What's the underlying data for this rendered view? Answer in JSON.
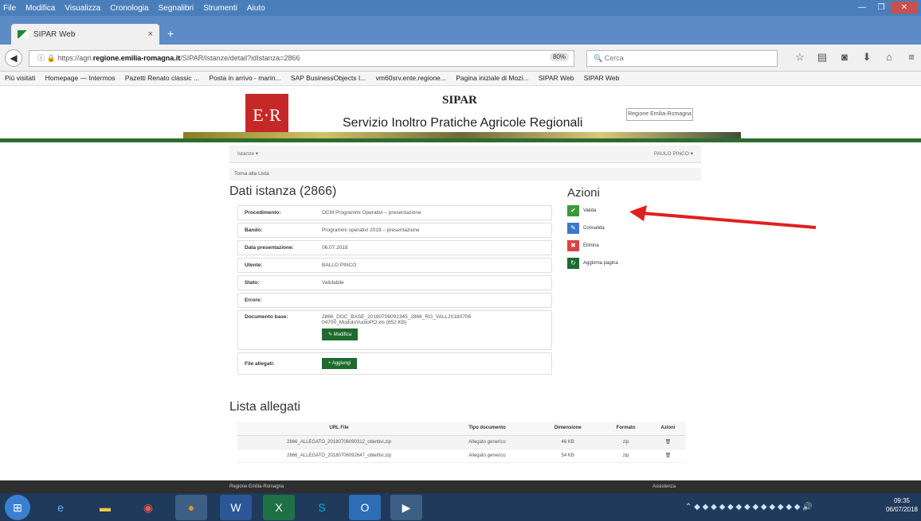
{
  "menu": [
    "File",
    "Modifica",
    "Visualizza",
    "Cronologia",
    "Segnalibri",
    "Strumenti",
    "Aiuto"
  ],
  "tab": {
    "title": "SIPAR Web",
    "close": "×",
    "newtab": "+"
  },
  "nav": {
    "url_prefix": "https://agri.",
    "url_domain": "regione.emilia-romagna.it",
    "url_path": "/SIPAR/istanze/detail?idIstanza=2866",
    "zoom": "80%",
    "search_placeholder": "Cerca"
  },
  "bookmarks": [
    "Più visitati",
    "Homepage — Intermos",
    "Pazetti Renato classic ...",
    "Posta in arrivo - marin...",
    "SAP BusinessObjects I...",
    "vm60srv.ente.regione...",
    "Pagina iniziale di Mozi...",
    "SIPAR Web",
    "SIPAR Web"
  ],
  "header": {
    "logo": "E·R",
    "app": "SIPAR",
    "subtitle": "Servizio Inoltro Pratiche Agricole Regionali",
    "region_logo": "Regione Emilia-Romagna"
  },
  "subnav": {
    "left": "Istanze ▾",
    "right": "PAULO PINCO ▾"
  },
  "back_link": "Torna alla Lista",
  "dati": {
    "title": "Dati istanza (2866)",
    "rows": [
      {
        "k": "Procedimento:",
        "v": "OCM Programmi Operativi – presentazione"
      },
      {
        "k": "Bando:",
        "v": "Programmi operativi 2019 – presentazione"
      },
      {
        "k": "Data presentazione:",
        "v": "06.07.2018"
      },
      {
        "k": "Utente:",
        "v": "BALLO PINCO"
      },
      {
        "k": "Stato:",
        "v": "Validabile"
      },
      {
        "k": "Errore:",
        "v": ""
      }
    ],
    "doc_label": "Documento base:",
    "doc_value": "2866_DOC_BASE_20180706091345_2866_RG_VALL20180706 04700_ModuloVuotoPO.xls (852 KB)",
    "modifica": "Modifica",
    "allegati_label": "File allegati:",
    "aggiungi": "Aggiungi"
  },
  "azioni": {
    "title": "Azioni",
    "items": [
      {
        "label": "Valida",
        "color": "#3a9a3a",
        "icon": "✔"
      },
      {
        "label": "Convalida",
        "color": "#3a7ac8",
        "icon": "✎"
      },
      {
        "label": "Elimina",
        "color": "#d64545",
        "icon": "🗑"
      },
      {
        "label": "Aggiorna pagina",
        "color": "#1e6b2e",
        "icon": "↻"
      }
    ]
  },
  "lista": {
    "title": "Lista allegati",
    "headers": [
      "URL File",
      "Tipo documento",
      "Dimensione",
      "Formato",
      "Azioni"
    ],
    "rows": [
      [
        "2866_ALLEGATO_20180706090312_obiettivi.zip",
        "Allegato generico",
        "46 KB",
        "zip"
      ],
      [
        "2866_ALLEGATO_20180706092647_obiettivi.zip",
        "Allegato generico",
        "54 KB",
        "zip"
      ]
    ]
  },
  "footer": {
    "left": "Regione Emilia-Romagna",
    "right": "Assistenza"
  },
  "clock": {
    "time": "09:35",
    "date": "06/07/2018"
  }
}
